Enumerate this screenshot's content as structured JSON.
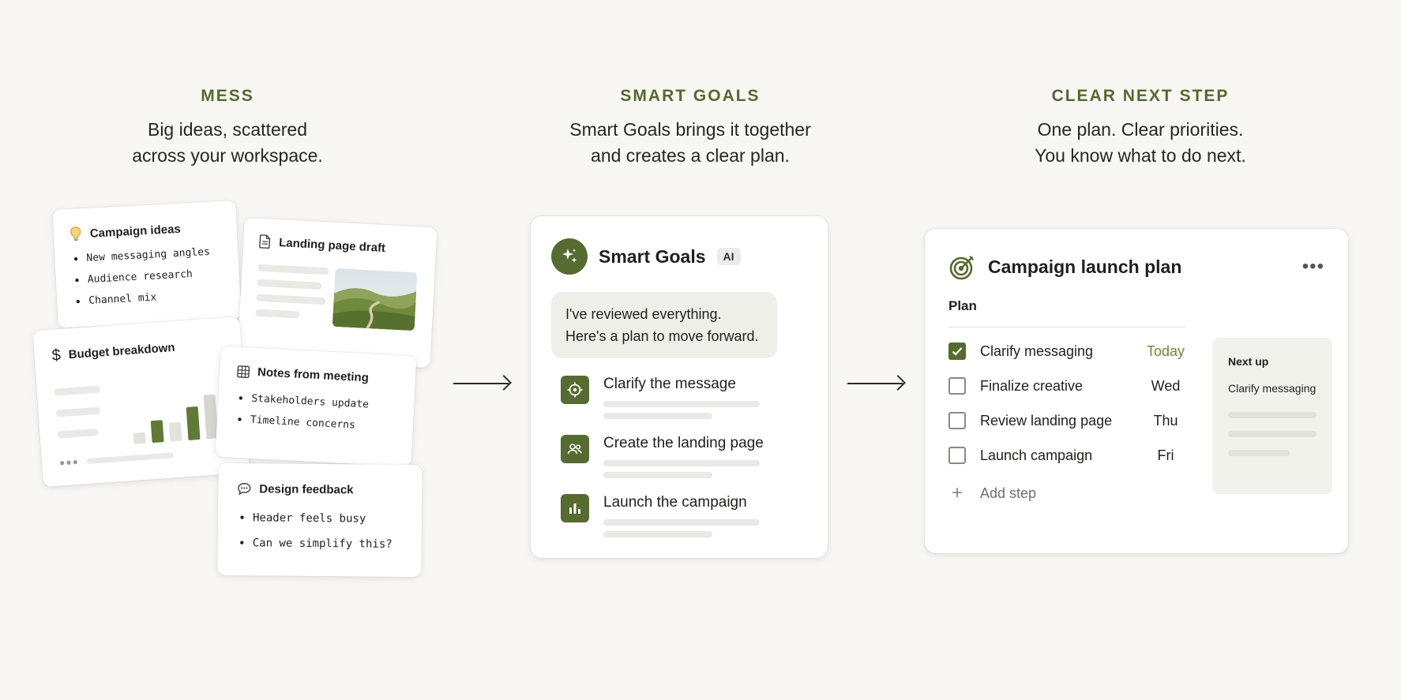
{
  "columns": {
    "mess": {
      "kicker": "MESS",
      "line1": "Big ideas, scattered",
      "line2": "across your workspace."
    },
    "smart": {
      "kicker": "SMART GOALS",
      "line1": "Smart Goals brings it together",
      "line2": "and creates a clear plan."
    },
    "next": {
      "kicker": "CLEAR NEXT STEP",
      "line1": "One plan. Clear priorities.",
      "line2": "You know what to do next."
    }
  },
  "mess_cards": {
    "campaign": {
      "title": "Campaign ideas",
      "icon": "lightbulb-icon",
      "items": [
        "New messaging angles",
        "Audience research",
        "Channel mix"
      ]
    },
    "landing": {
      "title": "Landing page draft",
      "icon": "document-icon"
    },
    "budget": {
      "title": "Budget breakdown",
      "icon": "dollar-icon"
    },
    "notes": {
      "title": "Notes from meeting",
      "icon": "table-icon",
      "items": [
        "Stakeholders update",
        "Timeline concerns"
      ]
    },
    "design": {
      "title": "Design feedback",
      "icon": "speech-bubble-icon",
      "items": [
        "Header feels busy",
        "Can we simplify this?"
      ]
    }
  },
  "smart_goals": {
    "title": "Smart Goals",
    "badge": "AI",
    "message_line1": "I've reviewed everything.",
    "message_line2": "Here's a plan to move forward.",
    "steps": [
      {
        "label": "Clarify the message",
        "icon": "target-icon"
      },
      {
        "label": "Create the landing page",
        "icon": "people-icon"
      },
      {
        "label": "Launch the campaign",
        "icon": "bar-chart-icon"
      }
    ]
  },
  "plan": {
    "title": "Campaign launch plan",
    "more_label": "•••",
    "section_label": "Plan",
    "tasks": [
      {
        "name": "Clarify messaging",
        "due": "Today",
        "checked": true
      },
      {
        "name": "Finalize creative",
        "due": "Wed",
        "checked": false
      },
      {
        "name": "Review landing page",
        "due": "Thu",
        "checked": false
      },
      {
        "name": "Launch campaign",
        "due": "Fri",
        "checked": false
      }
    ],
    "add_step": "Add step",
    "next_up": {
      "title": "Next up",
      "item": "Clarify messaging"
    }
  },
  "colors": {
    "accent": "#556b2f",
    "accent_text": "#55692e",
    "today": "#6b8a3a",
    "background": "#f8f7f4"
  }
}
